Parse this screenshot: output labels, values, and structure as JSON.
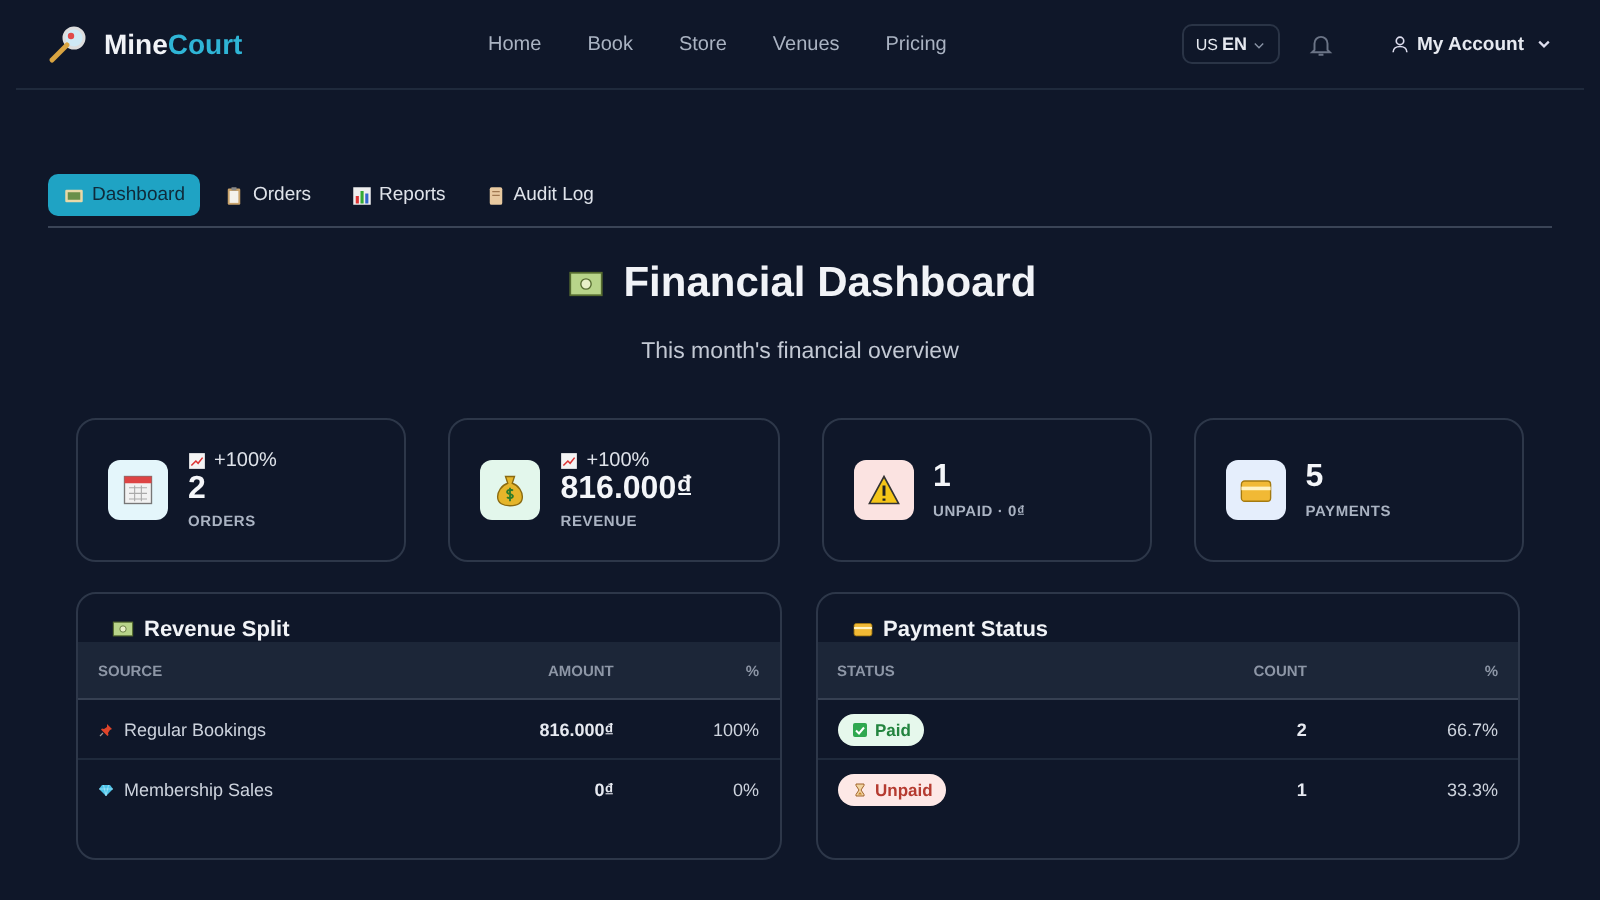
{
  "brand": {
    "first": "Mine",
    "second": "Court"
  },
  "nav": [
    "Home",
    "Book",
    "Store",
    "Venues",
    "Pricing"
  ],
  "language": {
    "flag": "US",
    "code": "EN"
  },
  "account": {
    "label": "My Account"
  },
  "tabs": [
    {
      "label": "Dashboard",
      "selected": true
    },
    {
      "label": "Orders",
      "selected": false
    },
    {
      "label": "Reports",
      "selected": false
    },
    {
      "label": "Audit Log",
      "selected": false
    }
  ],
  "title": "Financial Dashboard",
  "subtitle": "This month's financial overview",
  "stats": [
    {
      "trend": "+100%",
      "value": "2",
      "label": "ORDERS"
    },
    {
      "trend": "+100%",
      "value": "816.000₫",
      "label": "REVENUE"
    },
    {
      "value": "1",
      "label": "UNPAID · 0₫"
    },
    {
      "value": "5",
      "label": "PAYMENTS"
    }
  ],
  "revenue_split": {
    "title": "Revenue Split",
    "columns": [
      "SOURCE",
      "AMOUNT",
      "%"
    ],
    "rows": [
      {
        "source": "Regular Bookings",
        "amount": "816.000₫",
        "percent": "100%"
      },
      {
        "source": "Membership Sales",
        "amount": "0₫",
        "percent": "0%"
      }
    ]
  },
  "payment_status": {
    "title": "Payment Status",
    "columns": [
      "STATUS",
      "COUNT",
      "%"
    ],
    "rows": [
      {
        "kind": "paid",
        "status": "Paid",
        "count": "2",
        "percent": "66.7%"
      },
      {
        "kind": "unpaid",
        "status": "Unpaid",
        "count": "1",
        "percent": "33.3%"
      }
    ]
  }
}
